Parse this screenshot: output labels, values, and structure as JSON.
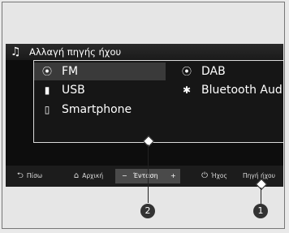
{
  "header": {
    "icon": "music-note-icon",
    "title": "Αλλαγή πηγής ήχου"
  },
  "sources": [
    {
      "label": "FM",
      "icon": "radio-antenna-icon",
      "selected": true
    },
    {
      "label": "DAB",
      "icon": "radio-antenna-icon",
      "selected": false
    },
    {
      "label": "USB",
      "icon": "usb-icon",
      "selected": false
    },
    {
      "label": "Bluetooth Audio",
      "icon": "bluetooth-icon",
      "selected": false
    },
    {
      "label": "Smartphone",
      "icon": "smartphone-icon",
      "selected": false
    }
  ],
  "bottom_bar": {
    "back": "Πίσω",
    "home": "Αρχική",
    "volume_minus": "−",
    "volume_label": "Ένταση",
    "volume_plus": "+",
    "sound": "Ήχος",
    "source": "Πηγή ήχου"
  },
  "callouts": [
    "1",
    "2"
  ]
}
